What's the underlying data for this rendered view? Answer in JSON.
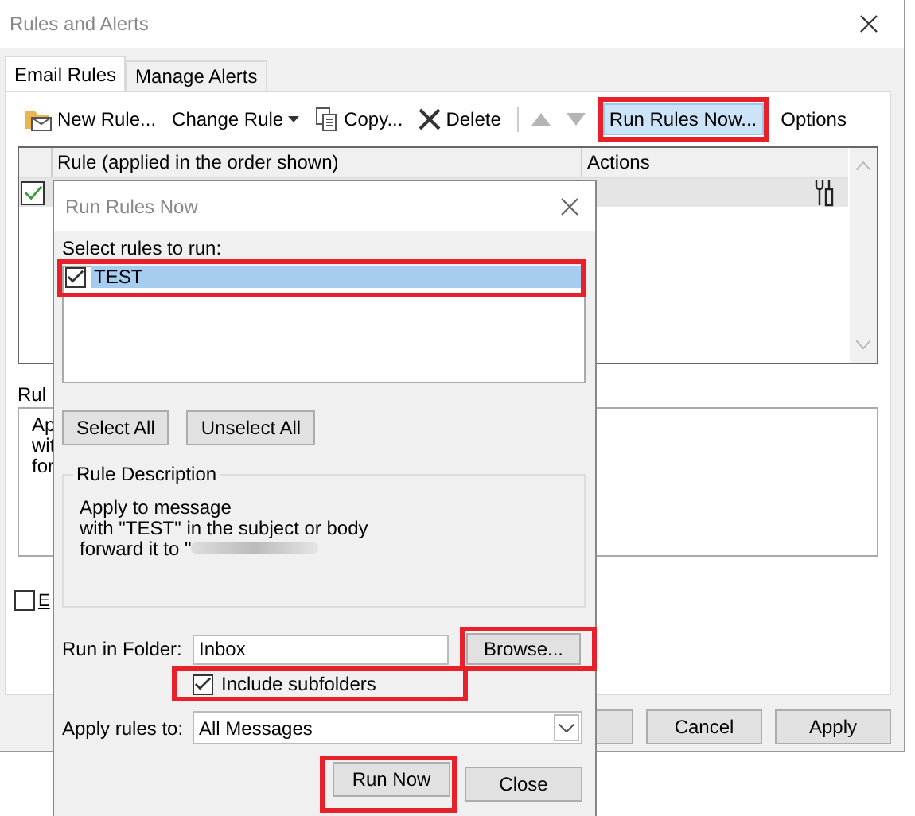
{
  "window": {
    "title": "Rules and Alerts"
  },
  "tabs": [
    {
      "label": "Email Rules",
      "selected": true
    },
    {
      "label": "Manage Alerts",
      "selected": false
    }
  ],
  "toolbar": [
    {
      "label": "New Rule...",
      "kind": "new",
      "highlighted": false
    },
    {
      "label": "Change Rule",
      "kind": "change",
      "highlighted": false
    },
    {
      "label": "Copy...",
      "kind": "copy",
      "highlighted": false
    },
    {
      "label": "Delete",
      "kind": "delete",
      "highlighted": false
    },
    {
      "kind": "up",
      "highlighted": false
    },
    {
      "kind": "down",
      "highlighted": false
    },
    {
      "label": "Run Rules Now...",
      "kind": "run",
      "highlighted": true
    },
    {
      "label": "Options",
      "kind": "options",
      "highlighted": false
    }
  ],
  "rules_table": {
    "columns": [
      "Rule (applied in the order shown)",
      "Actions"
    ],
    "rows": [
      {
        "checked": true
      }
    ]
  },
  "description_label": "Rul",
  "description_lines": [
    "Ap",
    "wit",
    "for"
  ],
  "option_checkbox": {
    "label": "E",
    "checked": false
  },
  "buttons": [
    "Cancel",
    "Apply"
  ],
  "dialog": {
    "title": "Run Rules Now",
    "list_label": "Select rules to run:",
    "rules": [
      {
        "name": "TEST",
        "checked": true,
        "selected": true,
        "highlighted": true
      }
    ],
    "list_buttons": [
      "Select All",
      "Unselect All"
    ],
    "description_title": "Rule Description",
    "description_lines": [
      "Apply to message",
      "with \"TEST\" in the subject or body",
      "forward it to \""
    ],
    "folder_label": "Run in Folder:",
    "folder": "Inbox",
    "browse": {
      "label": "Browse...",
      "highlighted": true
    },
    "include_subfolders": {
      "label": "Include subfolders",
      "checked": true,
      "highlighted": true
    },
    "apply_label": "Apply rules to:",
    "apply_value": "All Messages",
    "run_now": {
      "label": "Run Now",
      "highlighted": true
    },
    "close": "Close"
  }
}
